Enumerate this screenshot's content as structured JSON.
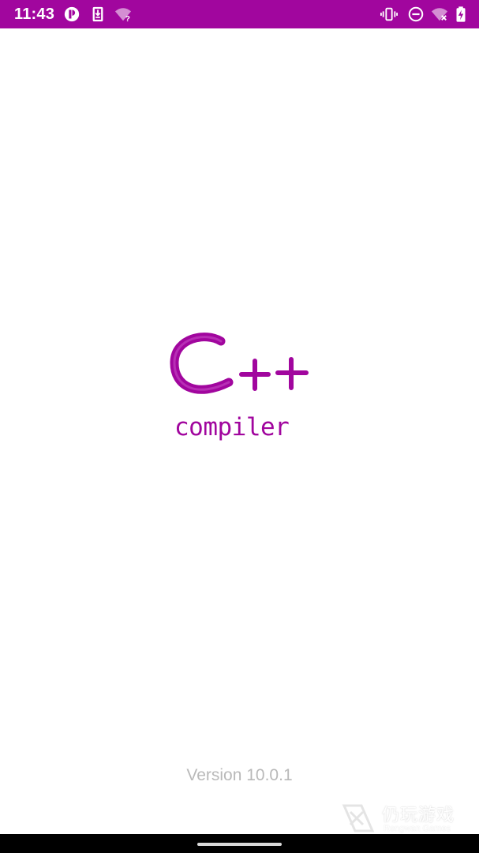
{
  "status_bar": {
    "time": "11:43",
    "background_color": "#a1069e",
    "left_icons": [
      "data-saver-icon",
      "download-notification-icon",
      "wifi-question-icon"
    ],
    "right_icons": [
      "vibrate-icon",
      "do-not-disturb-icon",
      "wifi-off-icon",
      "battery-charging-icon"
    ]
  },
  "splash": {
    "logo_main": "C++",
    "logo_sub": "compiler",
    "brand_color": "#a1069e",
    "version_text": "Version 10.0.1"
  },
  "watermark": {
    "title": "仍玩游戏",
    "subtitle": "Rengwan Games"
  }
}
